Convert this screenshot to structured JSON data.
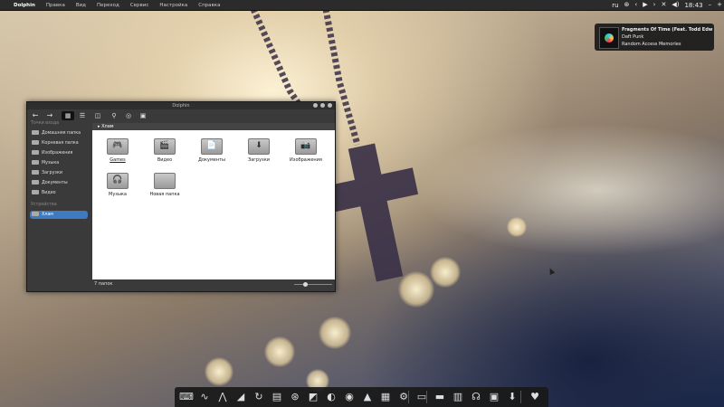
{
  "top_panel": {
    "app_name": "Dolphin",
    "menu": [
      "Правка",
      "Вид",
      "Переход",
      "Сервис",
      "Настройка",
      "Справка"
    ],
    "language": "ru",
    "clock": "18:43",
    "tray_icons": [
      "steam-icon",
      "chevron-left-icon",
      "play-icon",
      "chevron-right-icon",
      "x-icon",
      "volume-icon",
      "minus-icon",
      "plus-icon"
    ]
  },
  "notification": {
    "title": "Fragments Of Time (Feat. Todd Edw",
    "artist": "Daft Punk",
    "album": "Random Access Memories"
  },
  "window": {
    "title": "Dolphin",
    "sidebar": {
      "places_heading": "Точки входа",
      "places": [
        {
          "label": "Домашняя папка",
          "icon": "home-icon"
        },
        {
          "label": "Корневая папка",
          "icon": "drive-icon"
        },
        {
          "label": "Изображения",
          "icon": "pictures-icon"
        },
        {
          "label": "Музыка",
          "icon": "music-icon"
        },
        {
          "label": "Загрузки",
          "icon": "download-icon"
        },
        {
          "label": "Документы",
          "icon": "documents-icon"
        },
        {
          "label": "Видео",
          "icon": "video-icon"
        }
      ],
      "devices_heading": "Устройства",
      "devices": [
        {
          "label": "Хлам",
          "icon": "drive-icon",
          "selected": true
        }
      ]
    },
    "breadcrumb": "Хлам",
    "files": [
      {
        "label": "Games",
        "icon": "gamepad-icon",
        "glyph": "🎮"
      },
      {
        "label": "Видео",
        "icon": "video-icon",
        "glyph": "🎬"
      },
      {
        "label": "Документы",
        "icon": "documents-icon",
        "glyph": "📄"
      },
      {
        "label": "Загрузки",
        "icon": "download-icon",
        "glyph": "⬇"
      },
      {
        "label": "Изображения",
        "icon": "camera-icon",
        "glyph": "📷"
      },
      {
        "label": "Музыка",
        "icon": "headphones-icon",
        "glyph": "🎧"
      },
      {
        "label": "Новая папка",
        "icon": "folder-icon",
        "glyph": ""
      }
    ],
    "status": "7 папок"
  },
  "dock": {
    "items": [
      "terminal-icon",
      "pulse-icon",
      "dragon-icon",
      "bird-icon",
      "refresh-icon",
      "bag-icon",
      "steam-icon",
      "steam-alt-icon",
      "media-icon",
      "firefox-icon",
      "vlc-icon",
      "file-manager-icon",
      "settings-icon",
      "monitor-icon",
      "folder-icon",
      "documents-icon",
      "headphones-icon",
      "video-icon",
      "download-icon",
      "trash-icon"
    ]
  }
}
